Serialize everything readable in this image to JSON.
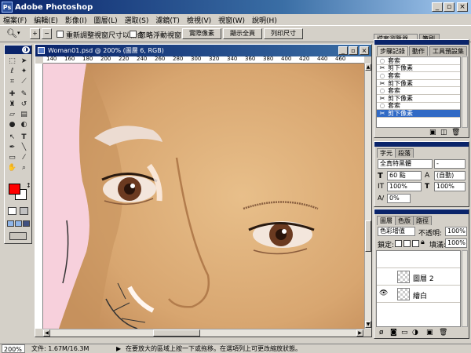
{
  "app": {
    "title": "Adobe Photoshop"
  },
  "menu": [
    "檔案(F)",
    "編輯(E)",
    "影像(I)",
    "圖層(L)",
    "選取(S)",
    "濾鏡(T)",
    "檢視(V)",
    "視窗(W)",
    "說明(H)"
  ],
  "options": {
    "resize_windows": "重新調整視窗尺寸以相合",
    "ignore_palettes": "忽略浮動視窗",
    "actual_pixels": "實際像素",
    "fit_on_screen": "顯示全頁",
    "print_size": "列印尺寸"
  },
  "tabs_top_right": [
    "檔案瀏覽器",
    "筆刷"
  ],
  "document": {
    "title": "Woman01.psd @ 200% (圖層 6, RGB)",
    "ruler_marks": [
      "140",
      "160",
      "180",
      "200",
      "220",
      "240",
      "260",
      "280",
      "300",
      "320",
      "340",
      "360",
      "380",
      "400",
      "420",
      "440",
      "460"
    ]
  },
  "history": {
    "tabs": [
      "步驟記錄",
      "動作",
      "工具預設集"
    ],
    "rows": [
      "套索",
      "剪下像素",
      "套索",
      "剪下像素",
      "套索",
      "剪下像素",
      "套索",
      "剪下像素"
    ]
  },
  "character": {
    "tabs": [
      "字元",
      "段落"
    ],
    "font": "全真特黑體",
    "style": "-",
    "size": "60 點",
    "leading": "(自動)",
    "vscale": "100%",
    "hscale": "100%",
    "tracking": "0%"
  },
  "layers": {
    "tabs": [
      "圖層",
      "色版",
      "路徑"
    ],
    "blend": "色彩增值",
    "opacity_label": "不透明:",
    "opacity": "100%",
    "lock_label": "鎖定:",
    "fill_label": "填滿:",
    "fill": "100%",
    "rows": [
      "圖層 2",
      "繪白"
    ]
  },
  "status": {
    "zoom": "200%",
    "doc_info": "文件: 1.67M/16.3M",
    "hint": "在要放大的區域上按一下或拖移。在選項列上可更改縮放狀態。"
  },
  "colors": {
    "foreground": "#ff0000",
    "background": "#ffffff",
    "title_blue": "#0a246a"
  }
}
